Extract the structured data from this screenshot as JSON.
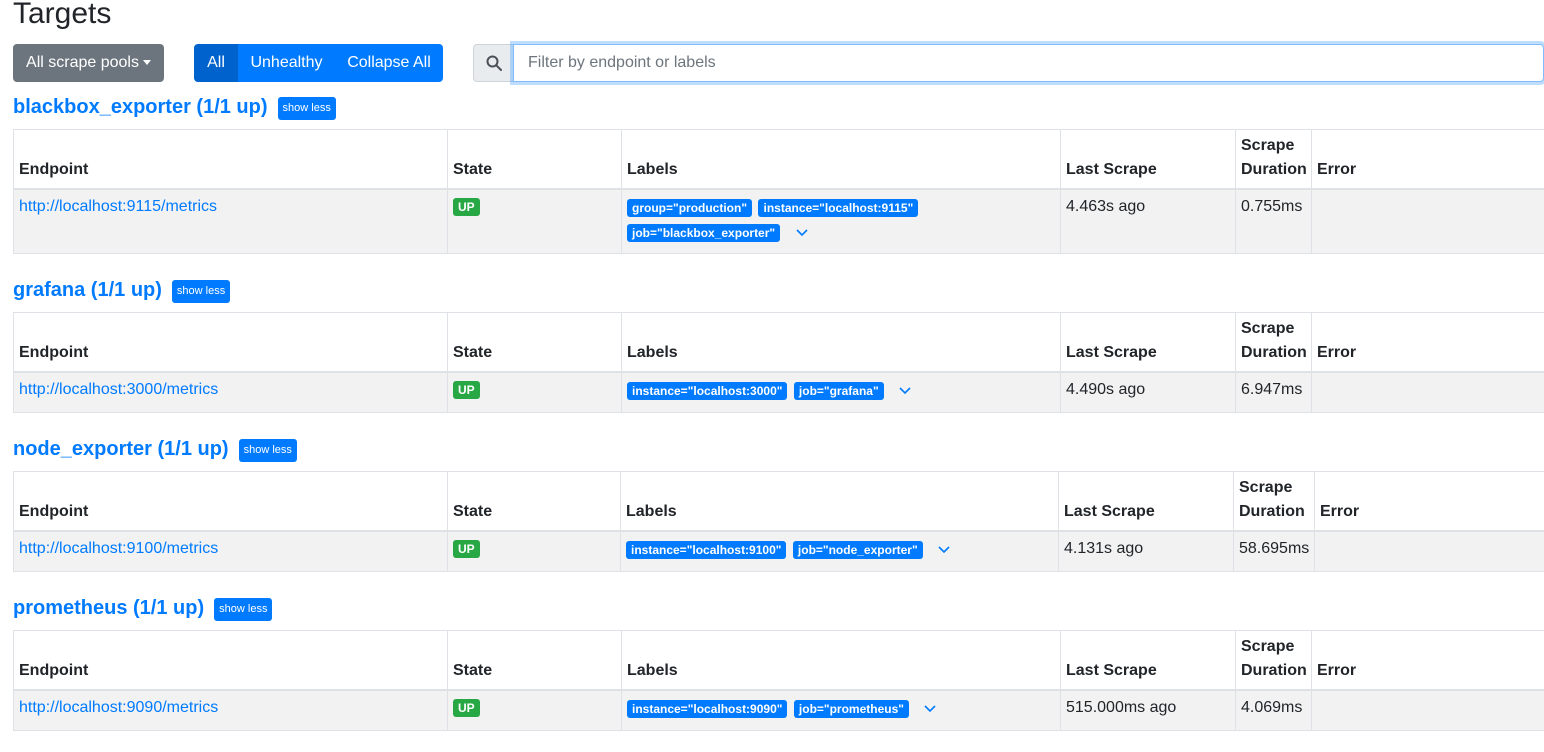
{
  "page": {
    "title": "Targets"
  },
  "toolbar": {
    "pools_label": "All scrape pools",
    "filter_all": "All",
    "filter_unhealthy": "Unhealthy",
    "collapse_all": "Collapse All",
    "search_placeholder": "Filter by endpoint or labels",
    "search_value": ""
  },
  "table_headers": {
    "endpoint": "Endpoint",
    "state": "State",
    "labels": "Labels",
    "last_scrape": "Last Scrape",
    "scrape_duration": "Scrape Duration",
    "error": "Error"
  },
  "colors": {
    "accent": "#007bff",
    "up": "#28a745",
    "pool_button": "#6c757d"
  },
  "pools": [
    {
      "title": "blackbox_exporter (1/1 up)",
      "show_less": "show less",
      "targets": [
        {
          "endpoint": "http://localhost:9115/metrics",
          "state": "UP",
          "labels": [
            "group=\"production\"",
            "instance=\"localhost:9115\"",
            "job=\"blackbox_exporter\""
          ],
          "last_scrape": "4.463s ago",
          "scrape_duration": "0.755ms",
          "error": ""
        }
      ]
    },
    {
      "title": "grafana (1/1 up)",
      "show_less": "show less",
      "targets": [
        {
          "endpoint": "http://localhost:3000/metrics",
          "state": "UP",
          "labels": [
            "instance=\"localhost:3000\"",
            "job=\"grafana\""
          ],
          "last_scrape": "4.490s ago",
          "scrape_duration": "6.947ms",
          "error": ""
        }
      ]
    },
    {
      "title": "node_exporter (1/1 up)",
      "show_less": "show less",
      "targets": [
        {
          "endpoint": "http://localhost:9100/metrics",
          "state": "UP",
          "labels": [
            "instance=\"localhost:9100\"",
            "job=\"node_exporter\""
          ],
          "last_scrape": "4.131s ago",
          "scrape_duration": "58.695ms",
          "error": ""
        }
      ]
    },
    {
      "title": "prometheus (1/1 up)",
      "show_less": "show less",
      "targets": [
        {
          "endpoint": "http://localhost:9090/metrics",
          "state": "UP",
          "labels": [
            "instance=\"localhost:9090\"",
            "job=\"prometheus\""
          ],
          "last_scrape": "515.000ms ago",
          "scrape_duration": "4.069ms",
          "error": ""
        }
      ]
    }
  ]
}
